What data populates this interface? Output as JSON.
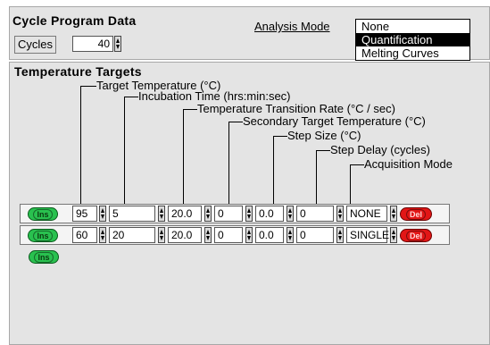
{
  "cycle_program": {
    "title": "Cycle Program Data",
    "cycles_label": "Cycles",
    "cycles_value": "40",
    "analysis_mode_label": "Analysis Mode",
    "analysis_mode_options": [
      "None",
      "Quantification",
      "Melting Curves"
    ],
    "analysis_mode_selected": "Quantification"
  },
  "temperature_targets": {
    "title": "Temperature Targets",
    "column_labels": {
      "target_temperature": "Target Temperature (°C)",
      "incubation_time": "Incubation Time (hrs:min:sec)",
      "transition_rate": "Temperature Transition Rate (°C / sec)",
      "secondary_target": "Secondary Target Temperature (°C)",
      "step_size": "Step Size (°C)",
      "step_delay": "Step Delay (cycles)",
      "acquisition_mode": "Acquisition Mode"
    },
    "ins_label": "Ins",
    "del_label": "Del",
    "rows": [
      {
        "target_temp": "95",
        "incubation_time": "5",
        "transition_rate": "20.0",
        "secondary_target": "0",
        "step_size": "0.0",
        "step_delay": "0",
        "acquisition_mode": "NONE"
      },
      {
        "target_temp": "60",
        "incubation_time": "20",
        "transition_rate": "20.0",
        "secondary_target": "0",
        "step_size": "0.0",
        "step_delay": "0",
        "acquisition_mode": "SINGLE"
      }
    ]
  },
  "colors": {
    "panel_bg": "#e4e4e4",
    "ins_button": "#29c14f",
    "del_button": "#e21616",
    "selection": "#000000"
  }
}
